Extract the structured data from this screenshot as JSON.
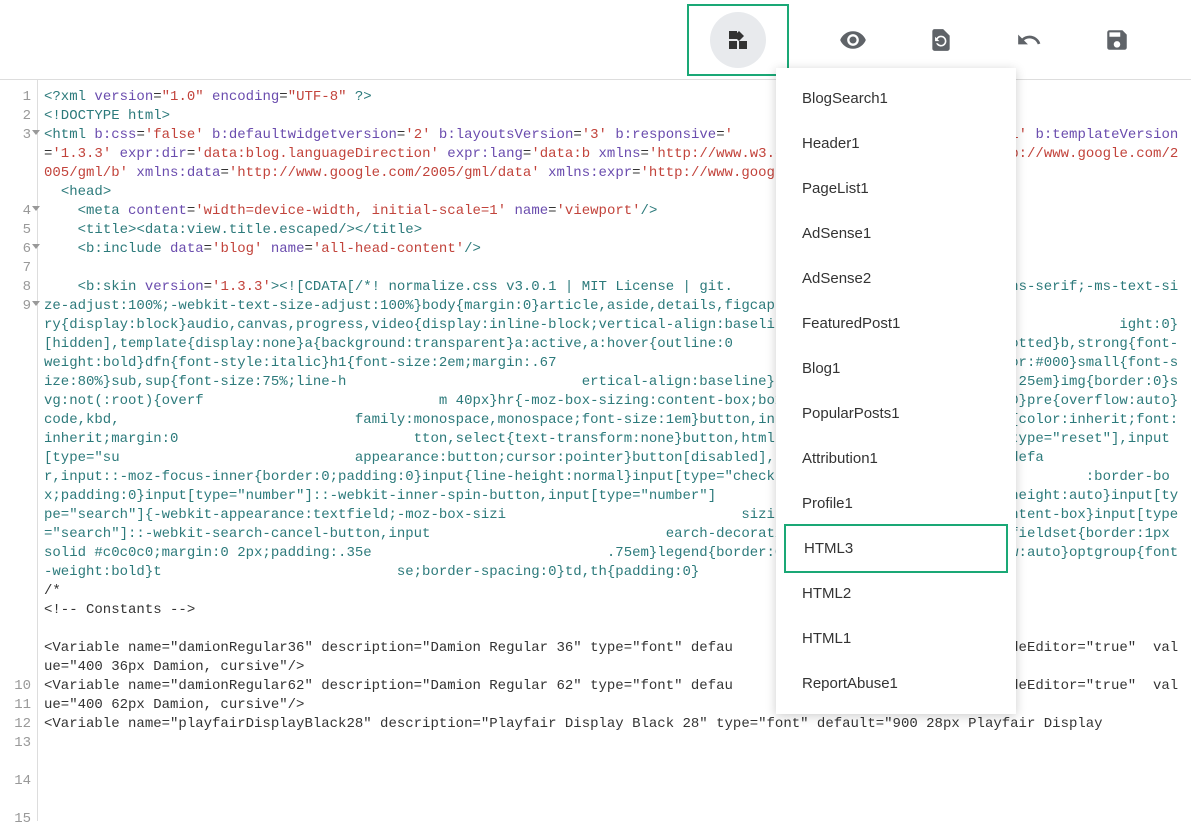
{
  "toolbar": {
    "widgets_btn": "widgets",
    "preview_btn": "preview",
    "revert_btn": "revert",
    "undo_btn": "undo",
    "save_btn": "save"
  },
  "dropdown": {
    "items": [
      "BlogSearch1",
      "Header1",
      "PageList1",
      "AdSense1",
      "AdSense2",
      "FeaturedPost1",
      "Blog1",
      "PopularPosts1",
      "Attribution1",
      "Profile1",
      "HTML3",
      "HTML2",
      "HTML1",
      "ReportAbuse1"
    ],
    "selected_index": 10
  },
  "gutter": {
    "lines": [
      "1",
      "2",
      "3",
      "4",
      "5",
      "6",
      "7",
      "8",
      "9",
      "10",
      "11",
      "12",
      "13",
      "14",
      "15"
    ],
    "fold_lines": [
      2,
      3,
      5,
      8
    ]
  },
  "code": {
    "l1_a": "<?xml",
    "l1_b": " version",
    "l1_c": "=",
    "l1_d": "\"1.0\"",
    "l1_e": " encoding",
    "l1_f": "=",
    "l1_g": "\"UTF-8\"",
    "l1_h": " ?>",
    "l2": "<!DOCTYPE html>",
    "l3_a": "<html",
    "l3_b": " b:css",
    "l3_c": "=",
    "l3_d": "'false'",
    "l3_e": " b:defaultwidgetversion",
    "l3_f": "=",
    "l3_g": "'2'",
    "l3_h": " b:layoutsVersion",
    "l3_i": "=",
    "l3_j": "'3'",
    "l3_k": " b:responsive",
    "l3_l": "=",
    "l3_m": "'                               xml'",
    "l3_n": "b:templateVersion",
    "l3_o": "=",
    "l3_p": "'1.3.3'",
    "l3_q": " expr:dir",
    "l3_r": "=",
    "l3_s": "'data:blog.languageDirection'",
    "l3_t": " expr:lang",
    "l3_u": "=",
    "l3_v": "'data:b",
    "l3_w": "xmlns",
    "l3_x": "=",
    "l3_y": "'http://www.w3.org/1999/xhtml'",
    "l3_z": " xmlns:b",
    "l3_aa": "=",
    "l3_ab": "'http://www.google.com/2005/gml/b'",
    "l3_ac": "xmlns:data",
    "l3_ad": "=",
    "l3_ae": "'http://www.google.com/2005/gml/data'",
    "l3_af": " xmlns:expr",
    "l3_ag": "=",
    "l3_ah": "'http://www.google.com",
    "l4_a": "  <head",
    "l4_b": ">",
    "l5_a": "    <meta",
    "l5_b": " content",
    "l5_c": "=",
    "l5_d": "'width=device-width, initial-scale=1'",
    "l5_e": " name",
    "l5_f": "=",
    "l5_g": "'viewport'",
    "l5_h": "/>",
    "l6_a": "    <title",
    "l6_b": ">",
    "l6_c": "<data:view.title.escaped",
    "l6_d": "/>",
    "l6_e": "</title>",
    "l7_a": "    <b:include",
    "l7_b": " data",
    "l7_c": "=",
    "l7_d": "'blog'",
    "l7_e": " name",
    "l7_f": "=",
    "l7_g": "'all-head-content'",
    "l7_h": "/>",
    "l9_a": "    <b:skin",
    "l9_b": " version",
    "l9_c": "=",
    "l9_d": "'1.3.3'",
    "l9_e": "><![CDATA[/*! normalize.css v3.0.1 | MIT License | git.                          mily:sans-serif;-ms-text-size-adjust:100%;-webkit-text-size-adjust:100%}body{margin:0}article,aside,details,figcaption,figure,footer,header,hg                           ry{display:block}audio,canvas,progress,video{display:inline-block;vertical-align:baseline}audio:not(                            ight:0}[hidden],template{display:none}a{background:transparent}a:active,a:hover{outline:0                            1px dotted}b,strong{font-weight:bold}dfn{font-style:italic}h1{font-size:2em;margin:.67                            0}mark{background:#ff0;color:#000}small{font-size:80%}sub,sup{font-size:75%;line-h                            ertical-align:baseline}sup{top:-0.5em}sub{bottom:-0.25em}img{border:0}svg:not(:root){overf                            m 40px}hr{-moz-box-sizing:content-box;box-sizing:content-box;height:0}pre{overflow:auto}code,kbd,                            family:monospace,monospace;font-size:1em}button,input,optgroup,select,textarea{color:inherit;font:inherit;margin:0                            tton,select{text-transform:none}button,html input[type=\"button\"],input[type=\"reset\"],input[type=\"su                            appearance:button;cursor:pointer}button[disabled],html input[disabled]{cursor:defa                            r,input::-moz-focus-inner{border:0;padding:0}input{line-height:normal}input[type=\"checkbox\"],inp                            :border-box;padding:0}input[type=\"number\"]::-webkit-inner-spin-button,input[type=\"number\"]                            button{height:auto}input[type=\"search\"]{-webkit-appearance:textfield;-moz-box-sizi                            sizing:content-box;box-sizing:content-box}input[type=\"search\"]::-webkit-search-cancel-button,input                            earch-decoration{-webkit-appearance:none}fieldset{border:1px solid #c0c0c0;margin:0 2px;padding:.35e                            .75em}legend{border:0;padding:0}textarea{overflow:auto}optgroup{font-weight:bold}t                            se;border-spacing:0}td,th{padding:0}",
    "l10": "/*",
    "l11": "<!-- Constants -->",
    "l13": "<Variable name=\"damionRegular36\" description=\"Damion Regular 36\" type=\"font\" defau                            e\" hideEditor=\"true\"  value=\"400 36px Damion, cursive\"/>",
    "l14": "<Variable name=\"damionRegular62\" description=\"Damion Regular 62\" type=\"font\" defau                            e\" hideEditor=\"true\"  value=\"400 62px Damion, cursive\"/>",
    "l15": "<Variable name=\"playfairDisplayBlack28\" description=\"Playfair Display Black 28\" type=\"font\" default=\"900 28px Playfair Display"
  }
}
